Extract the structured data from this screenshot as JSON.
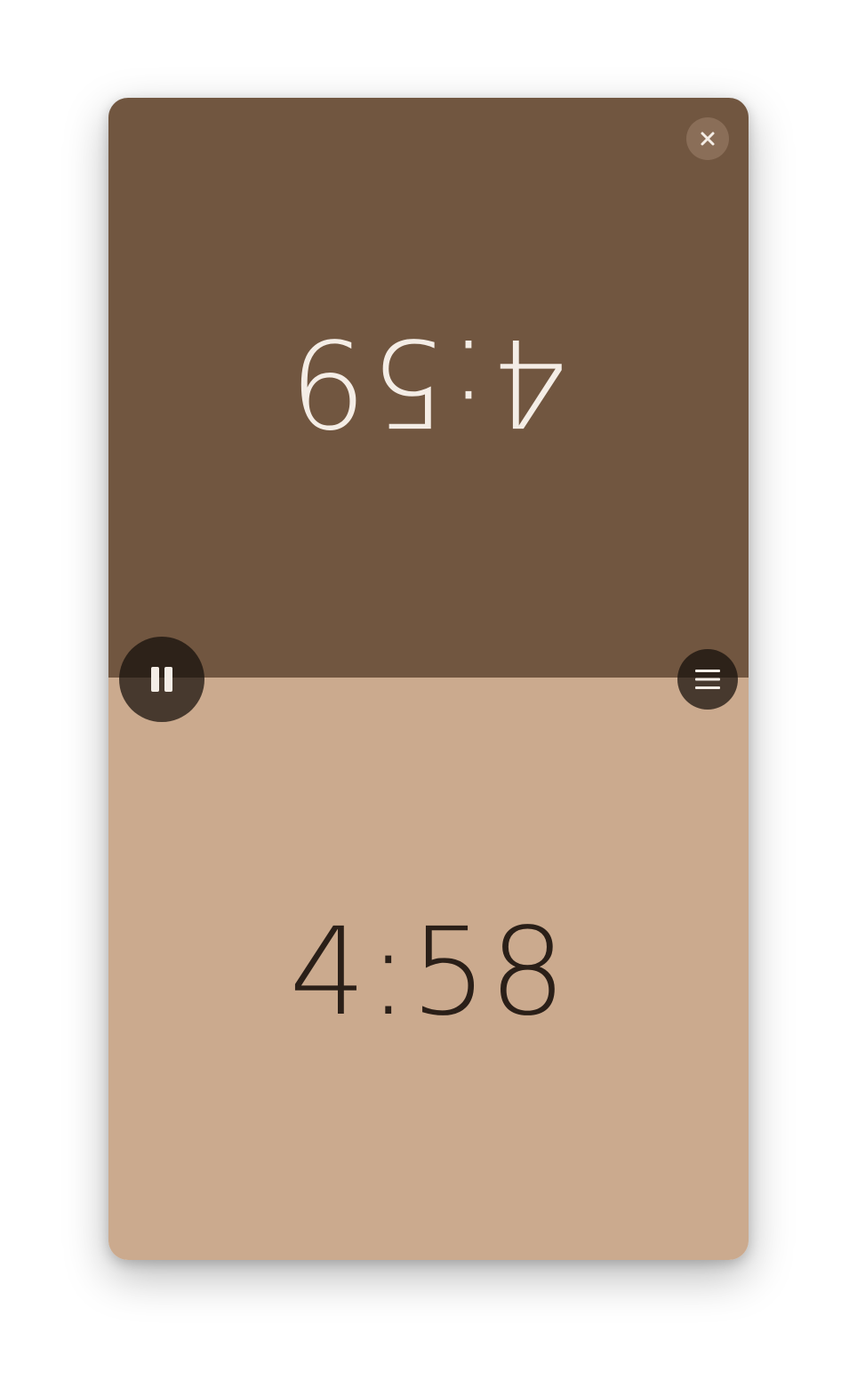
{
  "colors": {
    "top_panel": "#715640",
    "bottom_panel": "#cbaa8e",
    "top_text": "#f4ede6",
    "bottom_text": "#2a1f18",
    "close_button_bg": "#8a6e58",
    "control_button_bg": "rgba(20,14,10,0.72)",
    "icon_color": "#f4ede6"
  },
  "players": {
    "top": {
      "time": "4:59"
    },
    "bottom": {
      "time": "4:58"
    }
  },
  "controls": {
    "close_icon": "close-icon",
    "pause_icon": "pause-icon",
    "menu_icon": "menu-icon"
  }
}
